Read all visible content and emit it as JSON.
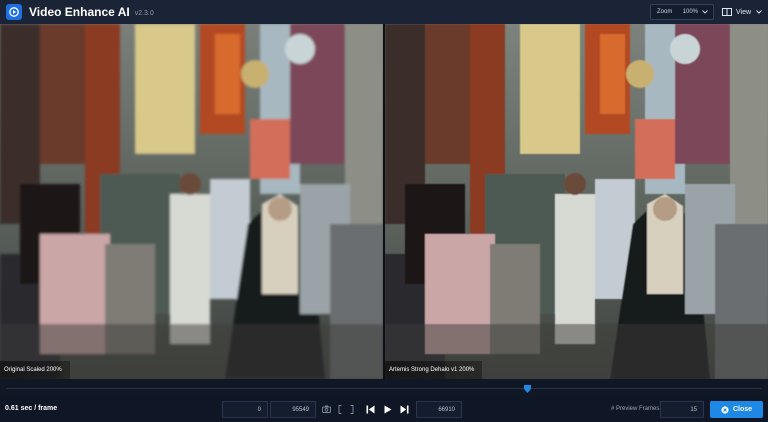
{
  "app": {
    "title": "Video Enhance AI",
    "version": "v2.3.0"
  },
  "toolbar": {
    "zoom_label": "Zoom",
    "zoom_value": "100%",
    "view_label": "View"
  },
  "panes": {
    "left_caption": "Original Scaled 200%",
    "right_caption": "Artemis Strong Dehalo v1 200%"
  },
  "timeline": {
    "position_fraction": 0.69
  },
  "bottom": {
    "speed": "0.61 sec / frame",
    "range_start": "0",
    "range_end": "95549",
    "current_frame": "66910",
    "preview_frames_label": "# Preview Frames",
    "preview_frames_value": "15",
    "close_label": "Close"
  },
  "colors": {
    "accent": "#1e88e5",
    "background": "#0f1726",
    "titlebar": "#1a2436"
  },
  "icons": [
    "app-logo-icon",
    "chevron-down-icon",
    "camera-icon",
    "bracket-left-icon",
    "bracket-right-icon",
    "step-back-icon",
    "play-icon",
    "step-forward-icon",
    "close-icon"
  ]
}
